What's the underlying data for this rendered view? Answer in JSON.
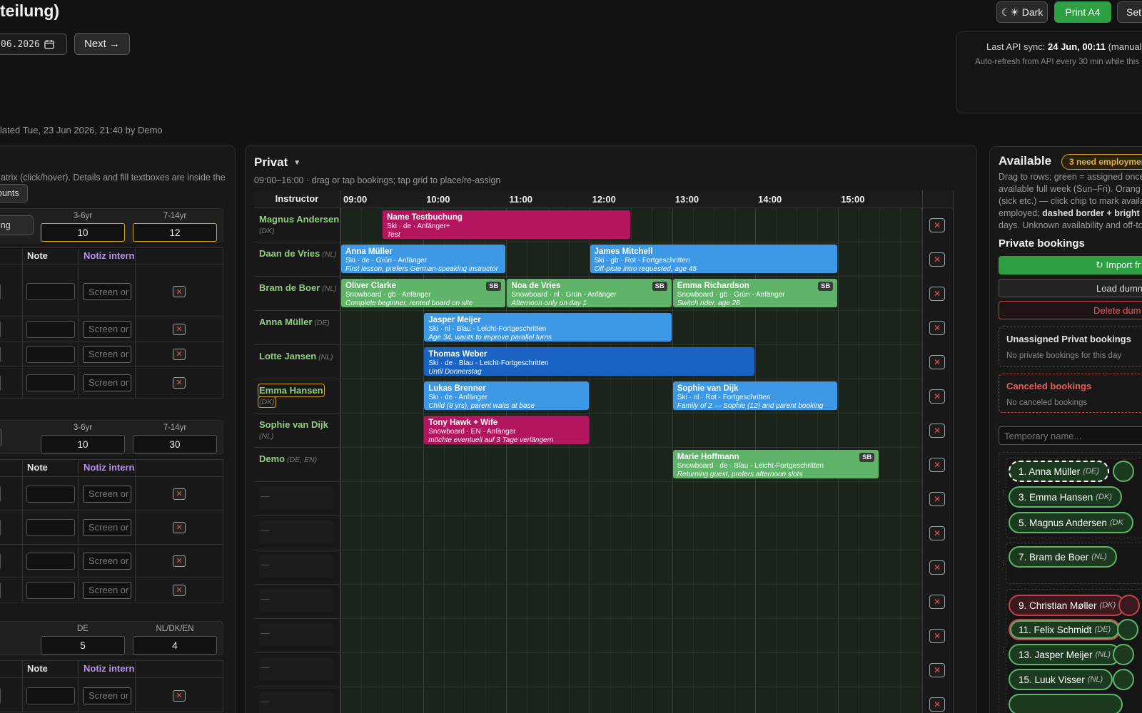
{
  "header": {
    "title_fragment": "teilung)",
    "dark_label": "☾☀ Dark",
    "print_label": "Print A4",
    "settings_label": "Set",
    "date_value": "06.2026",
    "next_label": "Next →",
    "updated_text": "lated Tue, 23 Jun 2026, 21:40 by Demo"
  },
  "api_sync": {
    "prefix": "Last API sync: ",
    "time": "24 Jun, 00:11",
    "suffix": " (manual)",
    "note": "Auto-refresh from API every 30 min while this"
  },
  "left_panel": {
    "hint": "atrix (click/hover). Details and fill textboxes are inside the",
    "counts_label": "ounts",
    "ing_label": "ing",
    "sections": [
      {
        "col_labels": [
          "3-6yr",
          "7-14yr"
        ],
        "values": [
          "10",
          "12"
        ],
        "highlight": true
      },
      {
        "col_labels": [
          "3-6yr",
          "7-14yr"
        ],
        "values": [
          "10",
          "30"
        ],
        "highlight": false
      },
      {
        "col_labels": [
          "DE",
          "NL/DK/EN"
        ],
        "values": [
          "5",
          "4"
        ],
        "highlight": false
      }
    ],
    "table_headers": {
      "note": "Note",
      "notiz": "Notiz intern"
    },
    "screen_placeholder": "Screen or",
    "orange_frag": "r"
  },
  "privat": {
    "title": "Privat",
    "subtitle": "09:00–16:00 · drag or tap bookings; tap grid to place/re-assign",
    "instructor_header": "Instructor",
    "hours": [
      "09:00",
      "10:00",
      "11:00",
      "12:00",
      "13:00",
      "14:00",
      "15:00"
    ],
    "empty_placeholder": "—",
    "instructors": [
      {
        "name": "Magnus Andersen",
        "lang": "(DK)",
        "wrap": true
      },
      {
        "name": "Daan de Vries",
        "lang": "(NL)",
        "wrap": false
      },
      {
        "name": "Bram de Boer",
        "lang": "(NL)",
        "wrap": false
      },
      {
        "name": "Anna Müller",
        "lang": "(DE)",
        "wrap": false
      },
      {
        "name": "Lotte Jansen",
        "lang": "(NL)",
        "wrap": false
      },
      {
        "name": "Emma Hansen",
        "lang": "(DK)",
        "wrap": true
      },
      {
        "name": "Sophie van Dijk",
        "lang": "(NL)",
        "wrap": true
      },
      {
        "name": "Demo",
        "lang": "(DE, EN)",
        "wrap": false
      }
    ],
    "bookings": [
      {
        "row": 0,
        "start": 9.5,
        "end": 12.5,
        "color": "magenta",
        "name": "Name Testbuchung",
        "detail": "Ski · de · Anfänger+",
        "note": "Test",
        "sb": false
      },
      {
        "row": 1,
        "start": 9.0,
        "end": 11.0,
        "color": "blue",
        "name": "Anna Müller",
        "detail": "Ski · de · Grün - Anfänger",
        "note": "First lesson, prefers German-speaking instructor",
        "sb": false
      },
      {
        "row": 1,
        "start": 12.0,
        "end": 15.0,
        "color": "blue",
        "name": "James Mitchell",
        "detail": "Ski · gb · Rot - Fortgeschritten",
        "note": "Off-piste intro requested, age 45",
        "sb": false
      },
      {
        "row": 2,
        "start": 9.0,
        "end": 11.0,
        "color": "green",
        "name": "Oliver Clarke",
        "detail": "Snowboard · gb · Anfänger",
        "note": "Complete beginner, rented board on site",
        "sb": true
      },
      {
        "row": 2,
        "start": 11.0,
        "end": 13.0,
        "color": "green",
        "name": "Noa de Vries",
        "detail": "Snowboard · nl · Grün - Anfänger",
        "note": "Afternoon only on day 1",
        "sb": true
      },
      {
        "row": 2,
        "start": 13.0,
        "end": 15.0,
        "color": "green",
        "name": "Emma Richardson",
        "detail": "Snowboard · gb · Grün - Anfänger",
        "note": "Switch rider, age 28",
        "sb": true
      },
      {
        "row": 3,
        "start": 10.0,
        "end": 13.0,
        "color": "blue",
        "name": "Jasper Meijer",
        "detail": "Ski · nl · Blau - Leicht-Fortgeschritten",
        "note": "Age 34, wants to improve parallel turns",
        "sb": false
      },
      {
        "row": 4,
        "start": 10.0,
        "end": 14.0,
        "color": "darkblue",
        "name": "Thomas Weber",
        "detail": "Ski · de · Blau - Leicht-Fortgeschritten",
        "note": "Until Donnerstag",
        "sb": false
      },
      {
        "row": 5,
        "start": 10.0,
        "end": 12.0,
        "color": "blue",
        "name": "Lukas Brenner",
        "detail": "Ski · de · Anfänger",
        "note": "Child (8 yrs), parent waits at base",
        "sb": false
      },
      {
        "row": 5,
        "start": 13.0,
        "end": 15.0,
        "color": "blue",
        "name": "Sophie van Dijk",
        "detail": "Ski · nl · Rot - Fortgeschritten",
        "note": "Family of 2 — Sophie (12) and parent booking",
        "sb": false
      },
      {
        "row": 6,
        "start": 10.0,
        "end": 12.0,
        "color": "magenta",
        "name": "Tony Hawk + Wife",
        "detail": "Snowboard · EN · Anfänger",
        "note": "möchte eventuell auf 3 Tage verlängern",
        "sb": false
      },
      {
        "row": 7,
        "start": 13.0,
        "end": 15.5,
        "color": "green",
        "name": "Marie Hoffmann",
        "detail": "Snowboard · de · Blau - Leicht-Fortgeschritten",
        "note": "Returning guest, prefers afternoon slots",
        "sb": true
      }
    ],
    "colors": {
      "magenta": "#b3165f",
      "blue": "#3d99e6",
      "darkblue": "#1a63c2",
      "green": "#5fb46a"
    }
  },
  "available": {
    "title": "Available",
    "badge": "3 need employmen",
    "desc_lines": [
      "Drag to rows; green = assigned once",
      "available full week (Sun–Fri). Orang",
      "(sick etc.) — click chip to mark availa",
      "employed; dashed border + bright",
      "days. Unknown availability and off-to"
    ],
    "desc_bold_3": "dashed border + bright",
    "private_bookings_title": "Private bookings",
    "import_label": "↻ Import fr",
    "load_label": "Load dumm",
    "delete_label": "Delete dum",
    "unassigned_title": "Unassigned Privat bookings",
    "unassigned_sub": "No private bookings for this day",
    "canceled_title": "Canceled bookings",
    "canceled_sub": "No canceled bookings",
    "temp_placeholder": "Temporary name...",
    "chips_group1": [
      {
        "label": "1. Anna Müller",
        "lang": "(DE)",
        "style": "dashed"
      },
      {
        "label": "3. Emma Hansen",
        "lang": "(DK)",
        "style": "green"
      },
      {
        "label": "5. Magnus Andersen",
        "lang": "(DK",
        "style": "green"
      }
    ],
    "chips_group2": [
      {
        "label": "7. Bram de Boer",
        "lang": "(NL)",
        "style": "green"
      }
    ],
    "chips_group3": [
      {
        "label": "9. Christian Møller",
        "lang": "(DK)",
        "style": "red"
      },
      {
        "label": "11. Felix Schmidt",
        "lang": "(DE)",
        "style": "redgreen"
      },
      {
        "label": "13. Jasper Meijer",
        "lang": "(NL)",
        "style": "green"
      },
      {
        "label": "15. Luuk Visser",
        "lang": "(NL)",
        "style": "green"
      }
    ]
  }
}
